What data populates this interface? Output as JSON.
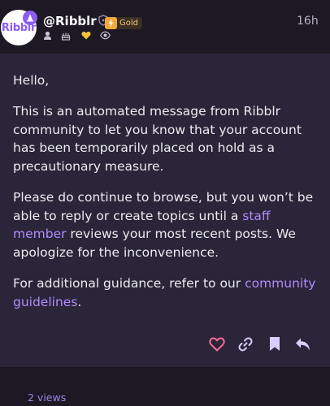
{
  "post": {
    "avatar_text": "Ribblr",
    "username": "@Ribblr",
    "badge": "Gold",
    "timestamp": "16h",
    "greeting": "Hello,",
    "p1": "This is an automated message from Ribblr community to let you know that your account has been temporarily placed on hold as a precautionary measure.",
    "p2_before": "Please do continue to browse, but you won’t be able to reply or create topics until a ",
    "p2_link": "staff member",
    "p2_after": " reviews your most recent posts. We apologize for the inconvenience.",
    "p3_before": "For additional guidance, refer to our ",
    "p3_link": "community guidelines",
    "p3_after": "."
  },
  "footer": {
    "views": "2 views"
  },
  "icons": {
    "user": "user-icon",
    "cake": "cake-icon",
    "heart_small": "heart-icon",
    "eye": "eye-icon",
    "like": "heart-icon",
    "link": "link-icon",
    "bookmark": "bookmark-icon",
    "reply": "reply-icon"
  },
  "colors": {
    "accent": "#b18cff",
    "brand": "#8b5cf6",
    "like": "#ff6b9a",
    "gold": "#f0a93c"
  }
}
